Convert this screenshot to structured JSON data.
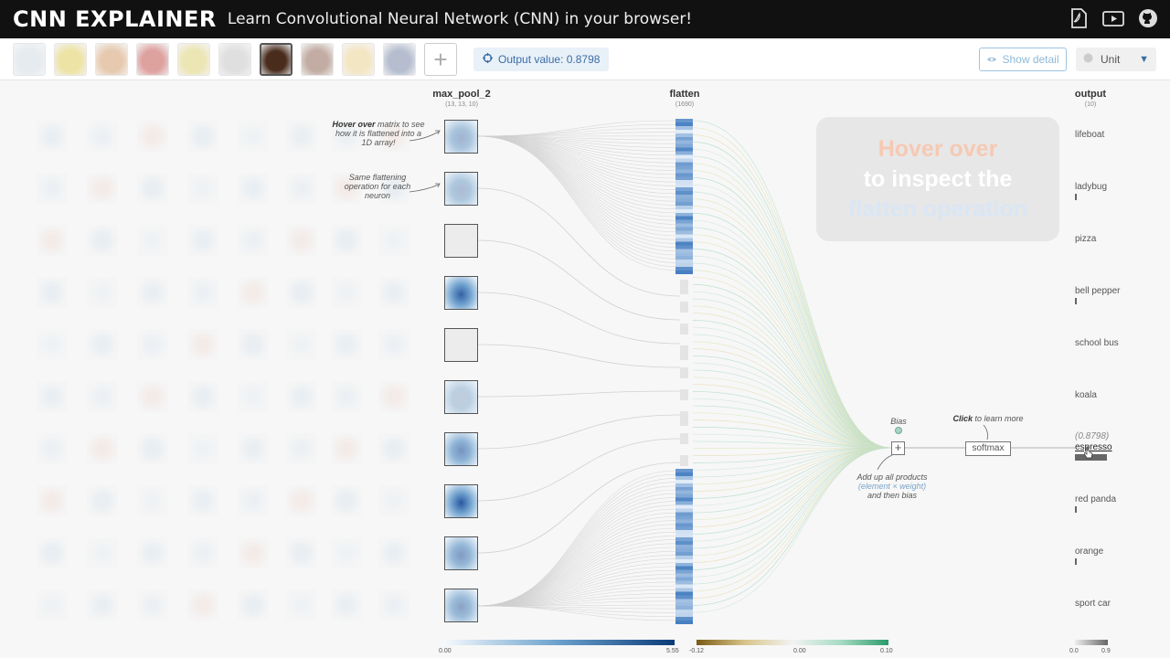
{
  "header": {
    "logo": "CNN EXPLAINER",
    "tagline": "Learn Convolutional Neural Network (CNN) in your browser!",
    "icons": [
      "pdf-icon",
      "video-icon",
      "github-icon"
    ]
  },
  "toolbar": {
    "output_value": "Output value: 0.8798",
    "show_detail": "Show detail",
    "unit": "Unit",
    "thumb_colors": [
      "#c9d4e0",
      "#d8c23a",
      "#c98a4e",
      "#b5302b",
      "#d6c65a",
      "#b9b9b9",
      "#4a2c1c",
      "#7a4a35",
      "#e6c87a",
      "#5c6f95"
    ]
  },
  "columns": {
    "max_pool_2": "max_pool_2",
    "max_pool_2_dims": "(13, 13, 10)",
    "flatten": "flatten",
    "flatten_dims": "(1690)",
    "output": "output",
    "output_dims": "(10)"
  },
  "annotations": {
    "hover_bold": "Hover over",
    "hover_rest": " matrix to see how it is flattened into a 1D array!",
    "same_flatten": "Same flattening operation for each neuron",
    "bias": "Bias",
    "click_bold": "Click",
    "click_rest": " to learn more",
    "add_products_1": "Add up all products",
    "add_products_2": "(element × weight)",
    "add_products_3": "and then bias",
    "softmax": "softmax"
  },
  "overlay": {
    "line1": "Hover over",
    "line2": "to inspect the",
    "line3": "flatten operation"
  },
  "output_classes": [
    {
      "label": "lifeboat",
      "value": 0.0
    },
    {
      "label": "ladybug",
      "value": 0.004
    },
    {
      "label": "pizza",
      "value": 0.0
    },
    {
      "label": "bell pepper",
      "value": 0.01
    },
    {
      "label": "school bus",
      "value": 0.0
    },
    {
      "label": "koala",
      "value": 0.0
    },
    {
      "label": "espresso",
      "value": 0.8798,
      "value_text": "(0.8798)"
    },
    {
      "label": "red panda",
      "value": 0.002
    },
    {
      "label": "orange",
      "value": 0.015
    },
    {
      "label": "sport car",
      "value": 0.0
    }
  ],
  "legends": {
    "blue_min": "0.00",
    "blue_max": "5.55",
    "div_min": "-0.12",
    "div_mid": "0.00",
    "div_max": "0.10",
    "gray_min": "0.0",
    "gray_max": "0.9"
  },
  "pool_nodes": [
    {
      "intensity": 0.35
    },
    {
      "intensity": 0.3
    },
    {
      "intensity": 0.0
    },
    {
      "intensity": 0.85
    },
    {
      "intensity": 0.0
    },
    {
      "intensity": 0.2
    },
    {
      "intensity": 0.55
    },
    {
      "intensity": 0.9
    },
    {
      "intensity": 0.5
    },
    {
      "intensity": 0.45
    }
  ]
}
